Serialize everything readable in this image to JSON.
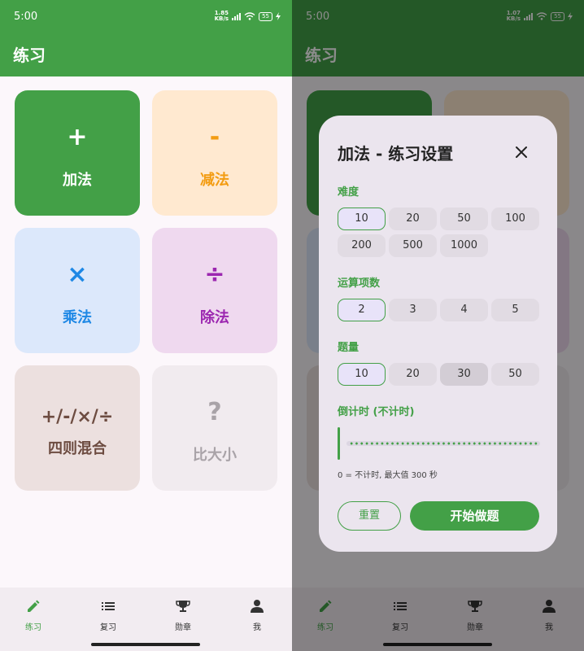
{
  "status": {
    "time": "5:00",
    "net_left": {
      "value": "1.85",
      "unit": "KB/s"
    },
    "net_right": {
      "value": "1.07",
      "unit": "KB/s"
    },
    "battery": "55"
  },
  "app": {
    "title": "练习"
  },
  "tiles": [
    {
      "symbol": "+",
      "label": "加法"
    },
    {
      "symbol": "-",
      "label": "减法"
    },
    {
      "symbol": "×",
      "label": "乘法"
    },
    {
      "symbol": "÷",
      "label": "除法"
    },
    {
      "symbol": "+/-/×/÷",
      "label": "四则混合"
    },
    {
      "symbol": "?",
      "label": "比大小"
    }
  ],
  "nav": [
    {
      "label": "练习",
      "icon": "pencil-icon"
    },
    {
      "label": "复习",
      "icon": "list-icon"
    },
    {
      "label": "勋章",
      "icon": "trophy-icon"
    },
    {
      "label": "我",
      "icon": "person-icon"
    }
  ],
  "dialog": {
    "title": "加法 - 练习设置",
    "difficulty": {
      "label": "难度",
      "options": [
        "10",
        "20",
        "50",
        "100",
        "200",
        "500",
        "1000"
      ],
      "selected": "10"
    },
    "terms": {
      "label": "运算项数",
      "options": [
        "2",
        "3",
        "4",
        "5"
      ],
      "selected": "2"
    },
    "count": {
      "label": "题量",
      "options": [
        "10",
        "20",
        "30",
        "50"
      ],
      "selected": "10"
    },
    "timer": {
      "label": "倒计时 (不计时)",
      "value": 0,
      "max": 300,
      "hint": "0 = 不计时, 最大值 300 秒"
    },
    "reset": "重置",
    "start": "开始做题"
  },
  "colors": {
    "primary": "#43a047",
    "orange": "#f39c12",
    "blue": "#1e88e5",
    "purple": "#9c27b0",
    "brown": "#6d4c41"
  }
}
